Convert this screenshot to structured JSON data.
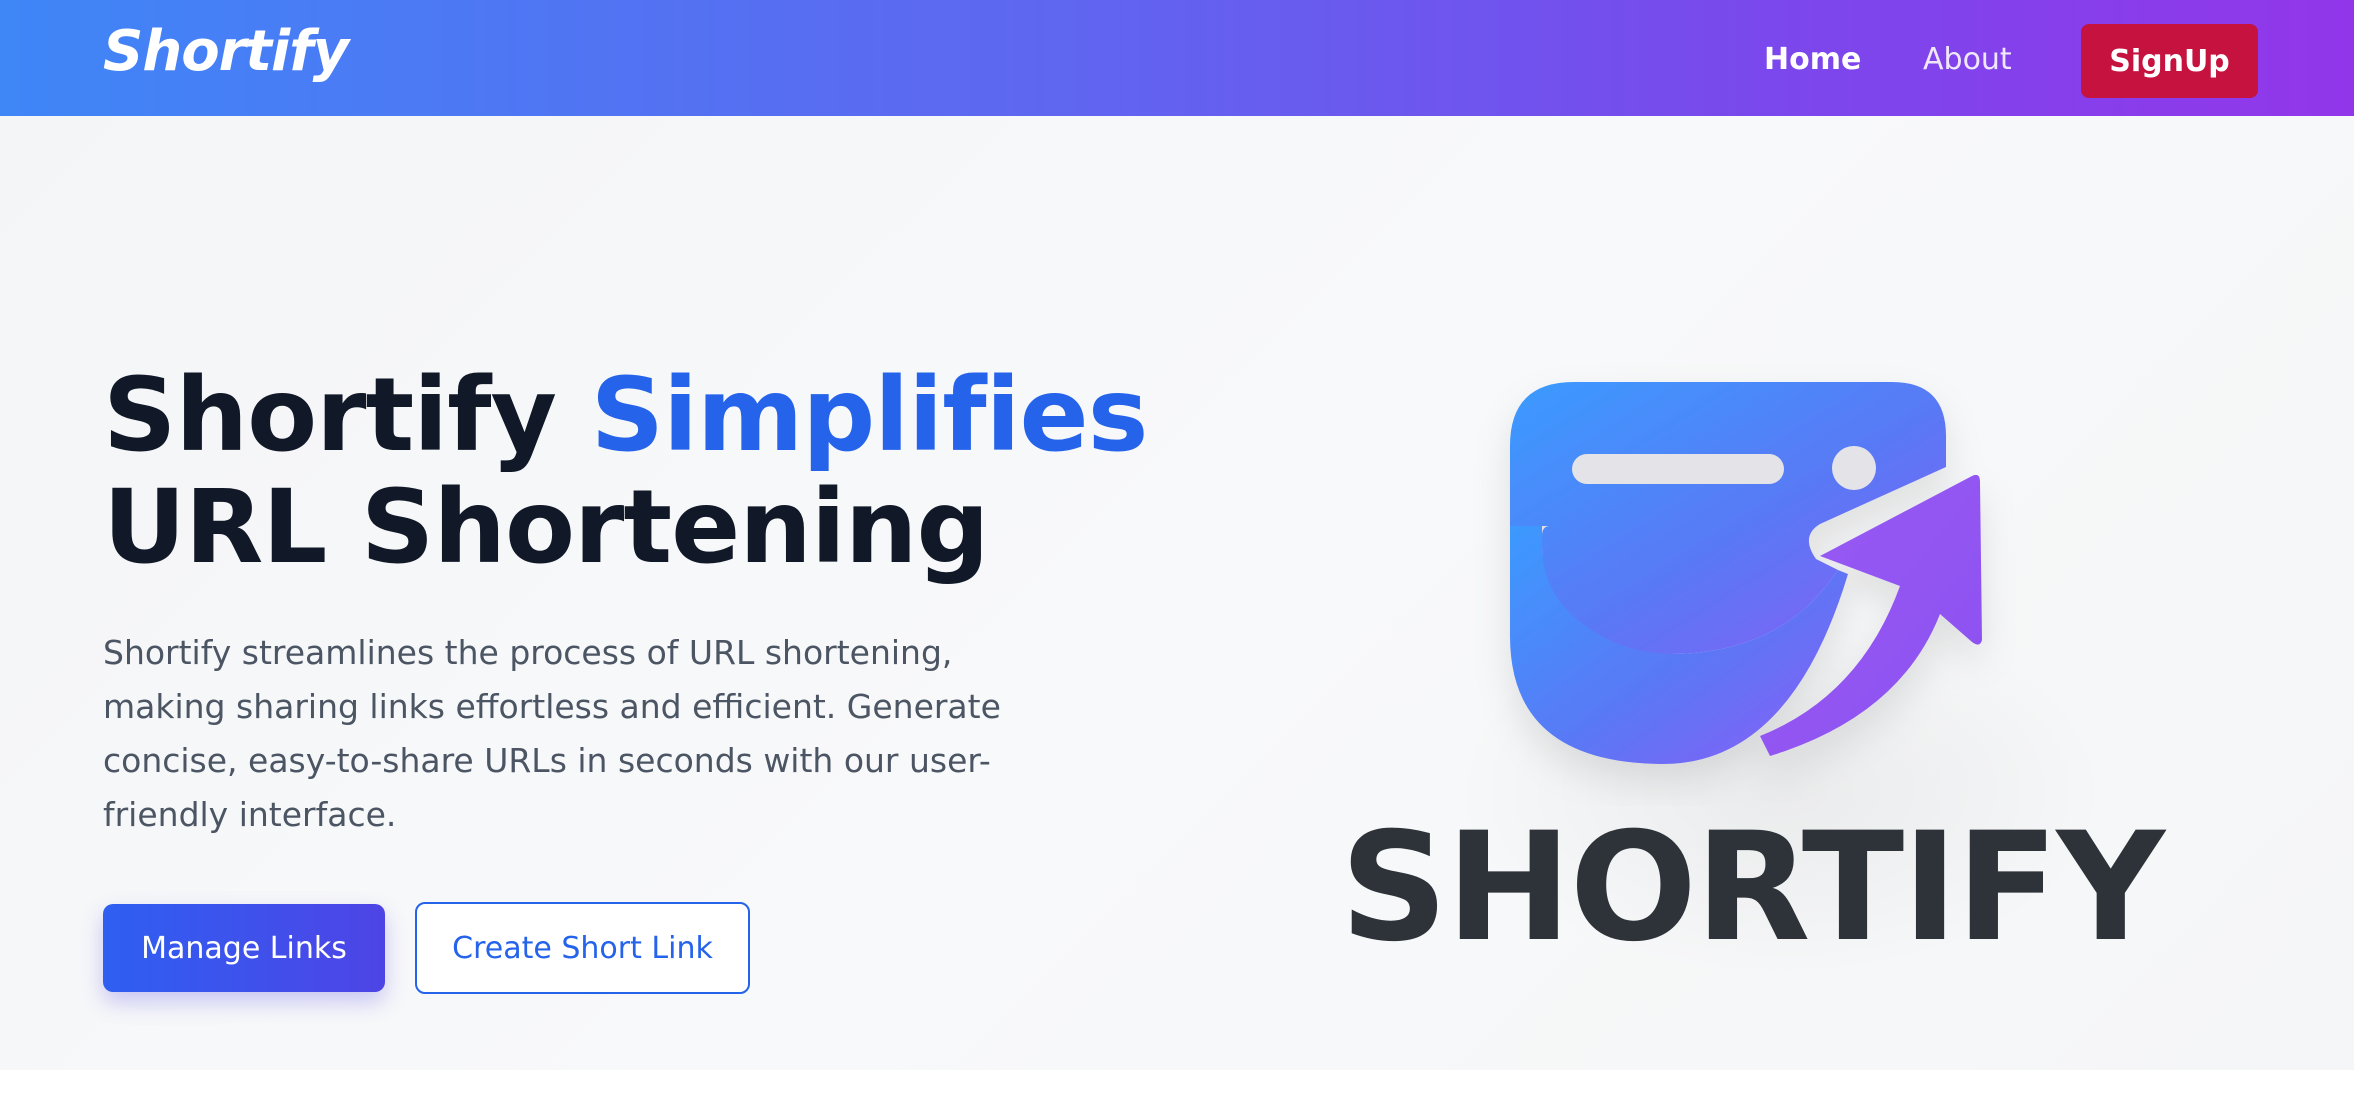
{
  "navbar": {
    "brand": "Shortify",
    "links": {
      "home": "Home",
      "about": "About"
    },
    "signup_label": "SignUp",
    "colors": {
      "gradient_start": "#3f86f7",
      "gradient_end": "#9236ea",
      "signup_bg": "#c5123f"
    }
  },
  "hero": {
    "title_part1": "Shortify ",
    "title_accent": "Simplifies",
    "title_part2": "URL Shortening",
    "description": "Shortify streamlines the process of URL shortening, making sharing links effortless and efficient. Generate concise, easy-to-share URLs in seconds with our user-friendly interface.",
    "primary_button": "Manage Links",
    "secondary_button": "Create Short Link",
    "colors": {
      "accent": "#2563eb",
      "title": "#111827",
      "text": "#4b5563"
    }
  },
  "logo": {
    "icon": "share-link-icon",
    "wordmark": "SHORTIFY"
  }
}
